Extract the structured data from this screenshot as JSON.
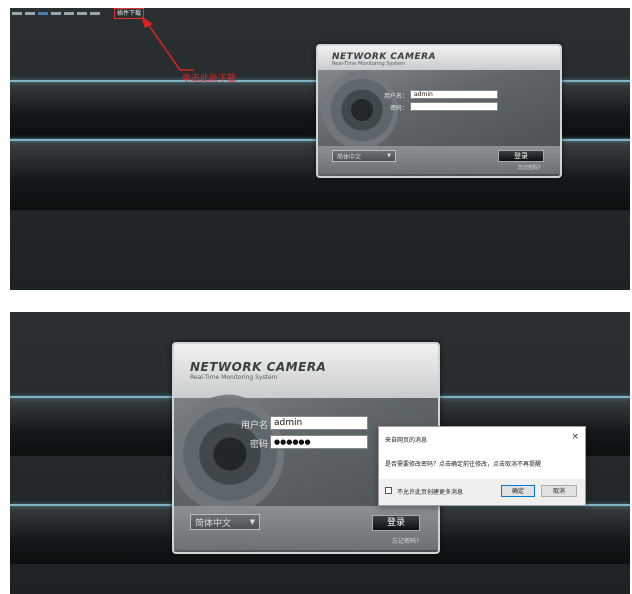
{
  "top_screen": {
    "download_link": "插件下载",
    "annotation": "单击此处下载",
    "brand": "NETWORK CAMERA",
    "tagline": "Real-Time Monitoring System",
    "username_label": "用户名：",
    "username_value": "admin",
    "password_label": "密码：",
    "password_value": "",
    "language": "简体中文",
    "login_button": "登录",
    "forgot_link": "忘记密码?"
  },
  "bottom_screen": {
    "brand": "NETWORK CAMERA",
    "tagline": "Real-Time Monitoring System",
    "username_label": "用户名",
    "username_value": "admin",
    "password_label": "密码",
    "password_value": "●●●●●●",
    "language": "简体中文",
    "login_button": "登录",
    "forgot_link": "忘记密码?"
  },
  "message_box": {
    "title": "来自网页的消息",
    "close": "×",
    "message": "是否需要修改密码？点击确定前往修改，点击取消不再提醒",
    "checkbox_label": "不允许此页创建更多消息",
    "ok_button": "确定",
    "cancel_button": "取消"
  },
  "colors": {
    "accent_line": "#7fb4c4",
    "annotation": "#e02020"
  },
  "icons": {
    "dropdown": "▼",
    "lens": "camera-lens-icon"
  }
}
